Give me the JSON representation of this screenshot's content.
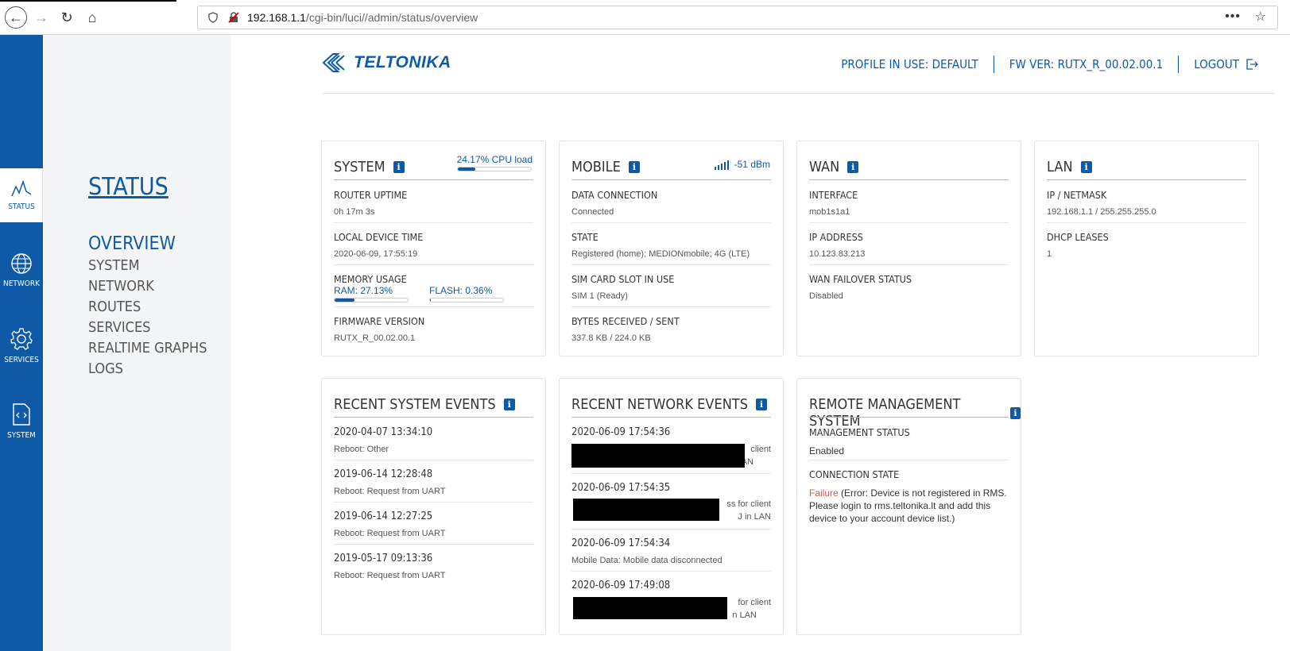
{
  "browser": {
    "url_host": "192.168.1.1",
    "url_path": "/cgi-bin/luci//admin/status/overview"
  },
  "sidebar": {
    "items": [
      {
        "label": "STATUS",
        "icon": "status-icon"
      },
      {
        "label": "NETWORK",
        "icon": "globe-icon"
      },
      {
        "label": "SERVICES",
        "icon": "gear-icon"
      },
      {
        "label": "SYSTEM",
        "icon": "code-file-icon"
      }
    ]
  },
  "menu": {
    "title": "STATUS",
    "items": [
      "OVERVIEW",
      "SYSTEM",
      "NETWORK",
      "ROUTES",
      "SERVICES",
      "REALTIME GRAPHS",
      "LOGS"
    ]
  },
  "header": {
    "logo": "TELTONIKA",
    "profile": "PROFILE IN USE: DEFAULT",
    "fw": "FW VER: RUTX_R_00.02.00.1",
    "logout": "LOGOUT"
  },
  "colors": {
    "accent": "#0f5aa6",
    "error": "#d9534f"
  },
  "system": {
    "title": "SYSTEM",
    "cpu_load": "24.17% CPU load",
    "cpu_fraction": 0.2417,
    "uptime_label": "ROUTER UPTIME",
    "uptime": "0h 17m 3s",
    "time_label": "LOCAL DEVICE TIME",
    "time": "2020-06-09, 17:55:19",
    "memory_label": "MEMORY USAGE",
    "ram": "RAM: 27.13%",
    "ram_fraction": 0.2713,
    "flash": "FLASH: 0.36%",
    "flash_fraction": 0.0036,
    "fw_label": "FIRMWARE VERSION",
    "fw": "RUTX_R_00.02.00.1"
  },
  "mobile": {
    "title": "MOBILE",
    "signal": "-51 dBm",
    "dc_label": "DATA CONNECTION",
    "dc": "Connected",
    "state_label": "STATE",
    "state": "Registered (home); MEDIONmobile; 4G (LTE)",
    "sim_label": "SIM CARD SLOT IN USE",
    "sim": "SIM 1 (Ready)",
    "bytes_label": "BYTES RECEIVED / SENT",
    "bytes": "337.8 KB / 224.0 KB"
  },
  "wan": {
    "title": "WAN",
    "iface_label": "INTERFACE",
    "iface": "mob1s1a1",
    "ip_label": "IP ADDRESS",
    "ip": "10.123.83.213",
    "failover_label": "WAN FAILOVER STATUS",
    "failover": "Disabled"
  },
  "lan": {
    "title": "LAN",
    "ip_label": "IP / NETMASK",
    "ip": "192.168.1.1 / 255.255.255.0",
    "dhcp_label": "DHCP LEASES",
    "dhcp": "1"
  },
  "sys_events": {
    "title": "RECENT SYSTEM EVENTS",
    "items": [
      {
        "time": "2020-04-07 13:34:10",
        "text": "Reboot: Other"
      },
      {
        "time": "2019-06-14 12:28:48",
        "text": "Reboot: Request from UART"
      },
      {
        "time": "2019-06-14 12:27:25",
        "text": "Reboot: Request from UART"
      },
      {
        "time": "2019-05-17 09:13:36",
        "text": "Reboot: Request from UART"
      }
    ]
  },
  "net_events": {
    "title": "RECENT NETWORK EVENTS",
    "items": [
      {
        "time": "2020-06-09 17:54:36",
        "line1": "client",
        "line2": "AN"
      },
      {
        "time": "2020-06-09 17:54:35",
        "line1": "ss for client",
        "line2": "J in LAN"
      },
      {
        "time": "2020-06-09 17:54:34",
        "text": "Mobile Data: Mobile data disconnected"
      },
      {
        "time": "2020-06-09 17:49:08",
        "line1": "for client",
        "line2": "n LAN"
      }
    ]
  },
  "rms": {
    "title": "REMOTE MANAGEMENT SYSTEM",
    "status_label": "MANAGEMENT STATUS",
    "status": "Enabled",
    "conn_label": "CONNECTION STATE",
    "failure": "Failure",
    "message": " (Error: Device is not registered in RMS. Please login to rms.teltonika.lt and add this device to your account device list.)"
  }
}
